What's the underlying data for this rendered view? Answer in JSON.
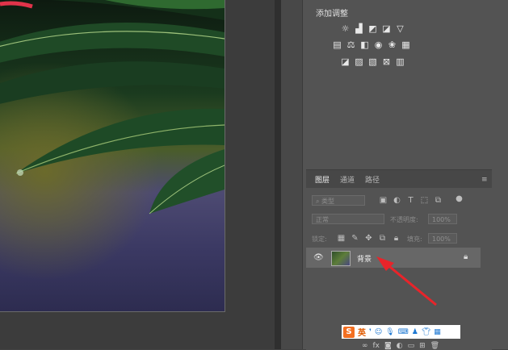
{
  "adjustments": {
    "title": "添加调整",
    "row1_icons": [
      "brightness-icon",
      "levels-icon",
      "curves-icon",
      "exposure-icon",
      "vibrance-icon"
    ],
    "row2_icons": [
      "hue-saturation-icon",
      "color-balance-icon",
      "black-white-icon",
      "photo-filter-icon",
      "channel-mixer-icon",
      "color-lookup-icon"
    ],
    "row3_icons": [
      "invert-icon",
      "posterize-icon",
      "threshold-icon",
      "selective-color-icon",
      "gradient-map-icon"
    ]
  },
  "layers_panel": {
    "tabs": [
      "图层",
      "通道",
      "路径"
    ],
    "filter_kind": "类型",
    "blend_mode": "正常",
    "opacity_label": "不透明度:",
    "opacity_value": "100%",
    "lock_label": "锁定:",
    "fill_label": "填充:",
    "fill_value": "100%",
    "layer_name": "背景"
  },
  "ime": {
    "logo": "S",
    "mode": "英"
  }
}
